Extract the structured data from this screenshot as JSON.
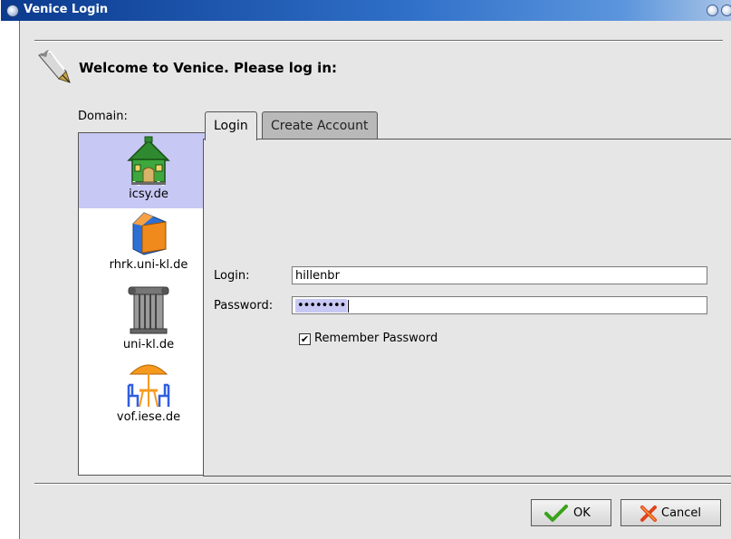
{
  "window": {
    "title": "Venice Login"
  },
  "header": {
    "text": "Welcome to Venice. Please log in:",
    "icon": "pen-writing-icon"
  },
  "domain": {
    "label": "Domain:",
    "items": [
      {
        "label": "icsy.de",
        "icon": "green-house-icon",
        "selected": true
      },
      {
        "label": "rhrk.uni-kl.de",
        "icon": "orange-blue-building-icon",
        "selected": false
      },
      {
        "label": "uni-kl.de",
        "icon": "column-pillar-icon",
        "selected": false
      },
      {
        "label": "vof.iese.de",
        "icon": "parasol-chairs-icon",
        "selected": false
      }
    ]
  },
  "tabs": [
    {
      "label": "Login",
      "active": true
    },
    {
      "label": "Create Account",
      "active": false
    }
  ],
  "form": {
    "login_label": "Login:",
    "login_value": "hillenbr",
    "password_label": "Password:",
    "password_mask": "••••••••",
    "remember_label": "Remember Password",
    "remember_checked": true
  },
  "buttons": {
    "ok": "OK",
    "cancel": "Cancel"
  },
  "colors": {
    "title_start": "#0b3a8e",
    "title_end": "#a9c4e6",
    "selection": "#c8c8f4",
    "window_bg": "#e6e6e6"
  }
}
